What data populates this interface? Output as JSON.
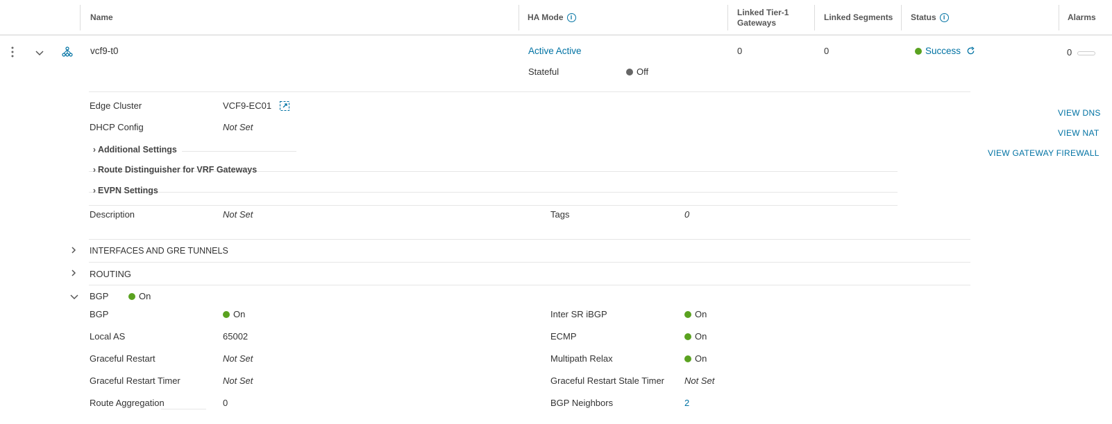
{
  "columns": {
    "name": "Name",
    "ha_mode": "HA Mode",
    "linked_tier1_line1": "Linked Tier-1",
    "linked_tier1_line2": "Gateways",
    "linked_segments": "Linked Segments",
    "status": "Status",
    "alarms": "Alarms"
  },
  "row": {
    "name": "vcf9-t0",
    "ha_mode": "Active Active",
    "linked_tier1": "0",
    "linked_segments": "0",
    "status": "Success",
    "alarms": "0",
    "stateful_label": "Stateful",
    "stateful_value": "Off"
  },
  "details": {
    "edge_cluster_label": "Edge Cluster",
    "edge_cluster_value": "VCF9-EC01",
    "dhcp_label": "DHCP Config",
    "dhcp_value": "Not Set",
    "additional_settings": "Additional Settings",
    "route_distinguisher": "Route Distinguisher for VRF Gateways",
    "evpn_settings": "EVPN Settings",
    "description_label": "Description",
    "description_value": "Not Set",
    "tags_label": "Tags",
    "tags_value": "0"
  },
  "actions": {
    "view_dns": "VIEW DNS",
    "view_nat": "VIEW NAT",
    "view_firewall": "VIEW GATEWAY FIREWALL"
  },
  "sections": {
    "interfaces": "INTERFACES AND GRE TUNNELS",
    "routing": "ROUTING",
    "bgp": "BGP",
    "bgp_status": "On"
  },
  "bgp": {
    "bgp_label": "BGP",
    "bgp_value": "On",
    "local_as_label": "Local AS",
    "local_as_value": "65002",
    "graceful_restart_label": "Graceful Restart",
    "graceful_restart_value": "Not Set",
    "graceful_restart_timer_label": "Graceful Restart Timer",
    "graceful_restart_timer_value": "Not Set",
    "route_aggregation_label": "Route Aggregation",
    "route_aggregation_value": "0",
    "inter_sr_label": "Inter SR iBGP",
    "inter_sr_value": "On",
    "ecmp_label": "ECMP",
    "ecmp_value": "On",
    "multipath_label": "Multipath Relax",
    "multipath_value": "On",
    "stale_timer_label": "Graceful Restart Stale Timer",
    "stale_timer_value": "Not Set",
    "neighbors_label": "BGP Neighbors",
    "neighbors_value": "2"
  },
  "colors": {
    "accent": "#0072a3",
    "success": "#5aa220",
    "off": "#666666"
  }
}
